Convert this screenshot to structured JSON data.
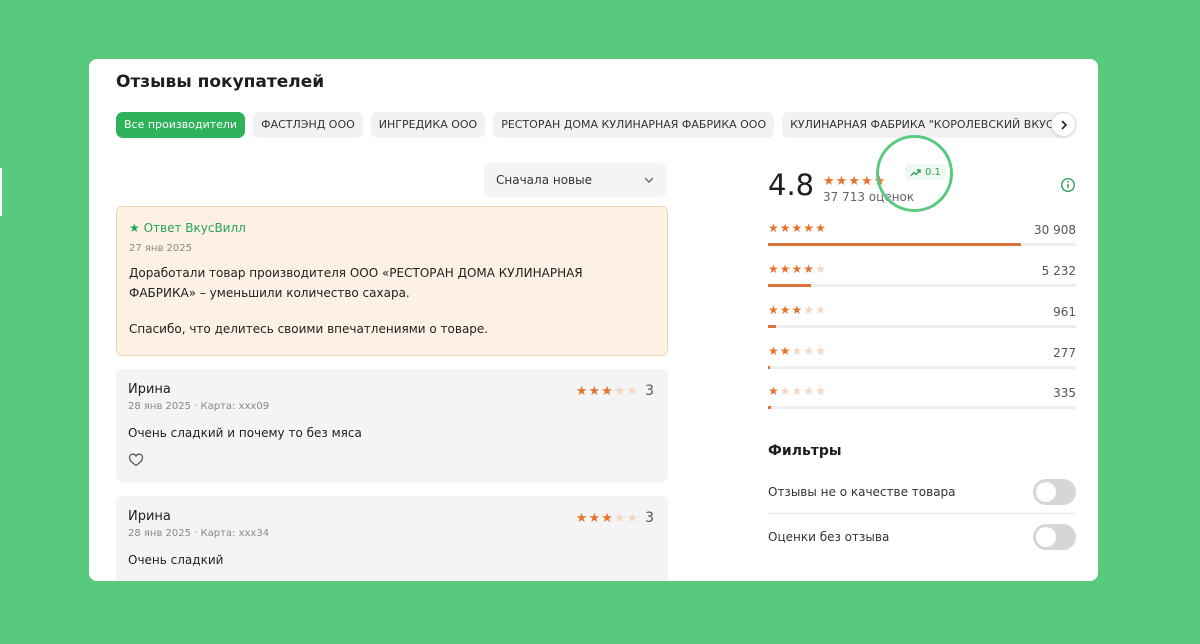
{
  "page_title": "Отзывы покупателей",
  "producers": [
    {
      "label": "Все производители",
      "active": true
    },
    {
      "label": "ФАСТЛЭНД ООО",
      "active": false
    },
    {
      "label": "ИНГРЕДИКА ООО",
      "active": false
    },
    {
      "label": "РЕСТОРАН ДОМА КУЛИНАРНАЯ ФАБРИКА ООО",
      "active": false
    },
    {
      "label": "КУЛИНАРНАЯ ФАБРИКА \"КОРОЛЕВСКИЙ ВКУС\"",
      "active": false
    }
  ],
  "icons": {
    "chips_next": "chevron-right-icon",
    "sort": "chevron-down-icon",
    "heart": "heart-icon",
    "trend": "trending-up-icon",
    "info": "info-icon",
    "star": "star-icon"
  },
  "sort": {
    "selected": "Сначала новые"
  },
  "reply": {
    "author": "★ Ответ ВкусВилл",
    "date": "27 янв 2025",
    "text1": "Доработали товар производителя ООО «РЕСТОРАН ДОМА КУЛИНАРНАЯ ФАБРИКА» – уменьшили количество сахара.",
    "text2": "Спасибо, что делитесь своими впечатлениями о товаре."
  },
  "reviews": [
    {
      "name": "Ирина",
      "meta": "28 янв 2025 · Карта: ххх09",
      "text": "Очень сладкий и почему то без мяса",
      "rating": 3
    },
    {
      "name": "Ирина",
      "meta": "28 янв 2025 · Карта: ххх34",
      "text": "Очень сладкий",
      "rating": 3
    }
  ],
  "summary": {
    "rating": "4.8",
    "rating_value": 4.8,
    "count_label": "37 713 оценок",
    "trend": "0.1"
  },
  "distribution": [
    {
      "stars": 5,
      "count": "30 908",
      "fraction": 0.82
    },
    {
      "stars": 4,
      "count": "5 232",
      "fraction": 0.139
    },
    {
      "stars": 3,
      "count": "961",
      "fraction": 0.025
    },
    {
      "stars": 2,
      "count": "277",
      "fraction": 0.007
    },
    {
      "stars": 1,
      "count": "335",
      "fraction": 0.009
    }
  ],
  "filters": {
    "title": "Фильтры",
    "items": [
      {
        "label": "Отзывы не о качестве товара",
        "on": false
      },
      {
        "label": "Оценки без отзыва",
        "on": false
      }
    ]
  },
  "colors": {
    "background": "#58c97e",
    "accent_green": "#2fb25c",
    "star": "#e4742d",
    "star_off": "#f3d7c3",
    "bar": "#d9743a"
  }
}
